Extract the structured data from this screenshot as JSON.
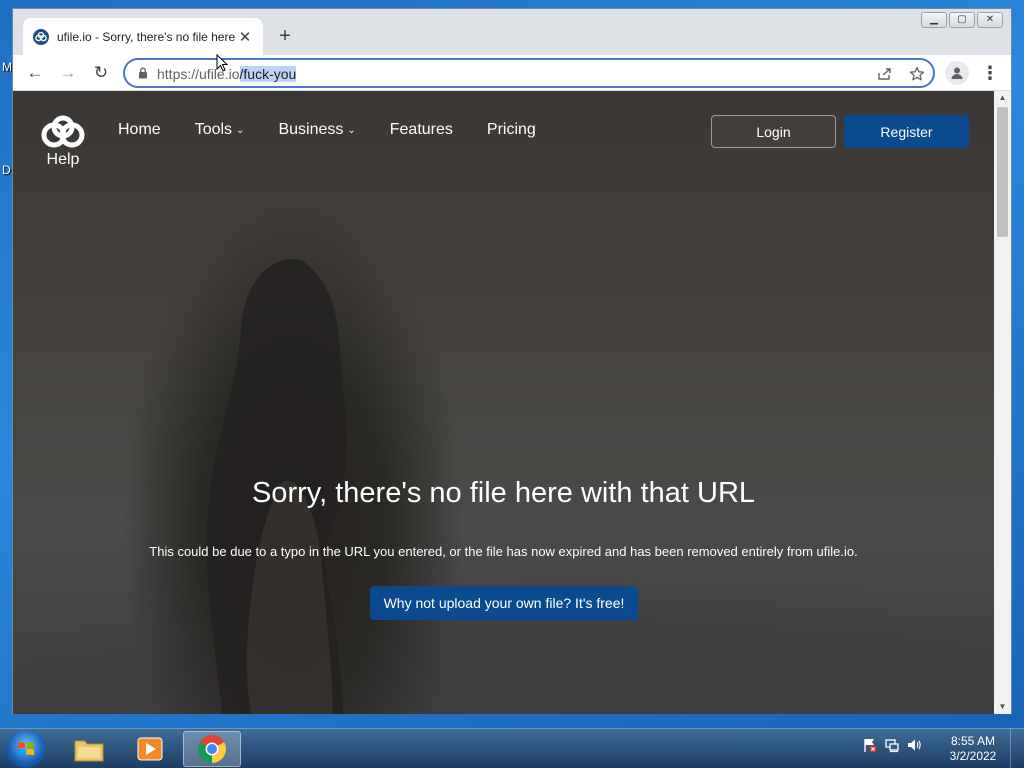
{
  "desktop": {
    "edge_labels": [
      "M",
      "D"
    ]
  },
  "browser": {
    "tab": {
      "title": "ufile.io - Sorry, there's no file here with that URL",
      "close_glyph": "✕"
    },
    "new_tab_glyph": "+",
    "window_buttons": {
      "minimize": "▁",
      "maximize": "▢",
      "close": "✕"
    },
    "toolbar": {
      "back_glyph": "←",
      "forward_glyph": "→",
      "reload_glyph": "↻"
    },
    "address_bar": {
      "url_prefix": "https://ufile.io",
      "url_selected": "/fuck-you"
    },
    "menu_glyph": "⋮"
  },
  "page": {
    "logo_label": "Help",
    "nav": [
      {
        "label": "Home",
        "has_caret": false
      },
      {
        "label": "Tools",
        "has_caret": true
      },
      {
        "label": "Business",
        "has_caret": true
      },
      {
        "label": "Features",
        "has_caret": false
      },
      {
        "label": "Pricing",
        "has_caret": false
      }
    ],
    "caret_glyph": "⌄",
    "login_label": "Login",
    "register_label": "Register",
    "heading": "Sorry, there's no file here with that URL",
    "subtext": "This could be due to a typo in the URL you entered, or the file has now expired and has been removed entirely from ufile.io.",
    "cta_label": "Why not upload your own file? It's free!"
  },
  "taskbar": {
    "clock_time": "8:55 AM",
    "clock_date": "3/2/2022"
  },
  "colors": {
    "brand_blue": "#0b4a8f",
    "omnibox_focus": "#4a76c7",
    "tab_strip": "#dee1e6"
  }
}
